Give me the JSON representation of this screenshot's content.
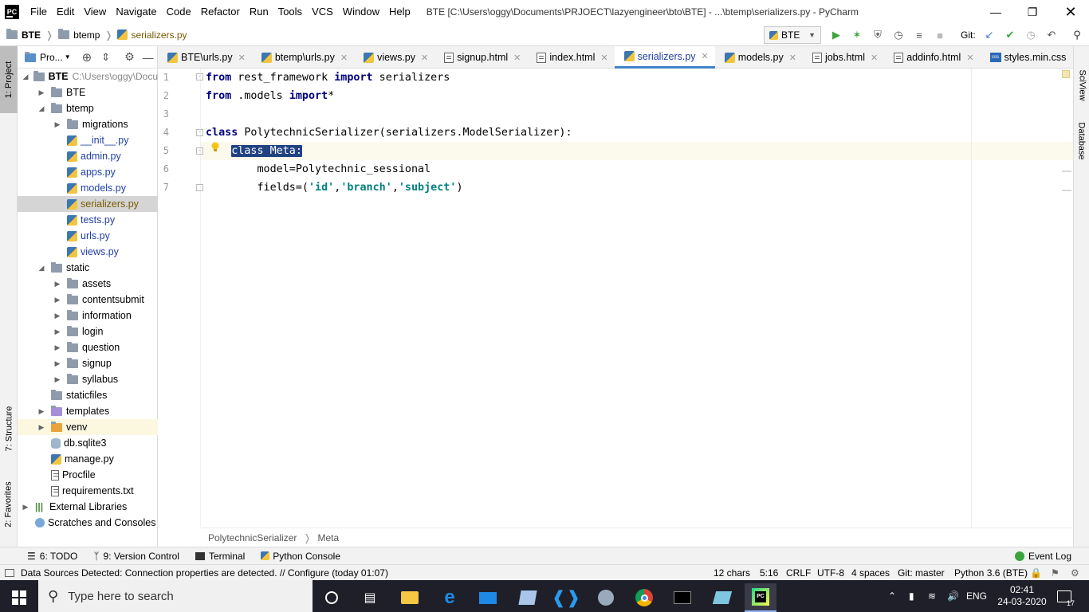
{
  "window": {
    "title": "BTE [C:\\Users\\oggy\\Documents\\PRJOECT\\lazyengineer\\bto\\BTE] - ...\\btemp\\serializers.py - PyCharm",
    "logo_text": "PC"
  },
  "menu": [
    "File",
    "Edit",
    "View",
    "Navigate",
    "Code",
    "Refactor",
    "Run",
    "Tools",
    "VCS",
    "Window",
    "Help"
  ],
  "navbar": {
    "crumbs": [
      "BTE",
      "btemp",
      "serializers.py"
    ],
    "run_config": "BTE",
    "git_label": "Git:"
  },
  "left_stripe": {
    "project": "1: Project",
    "structure": "7: Structure",
    "favorites": "2: Favorites"
  },
  "right_stripe": {
    "sciview": "SciView",
    "database": "Database"
  },
  "project_panel": {
    "title": "Pro...",
    "root": "BTE",
    "root_path": "C:\\Users\\oggy\\Docu",
    "items": [
      {
        "label": "BTE",
        "type": "folder",
        "depth": 1,
        "arrow": "collapsed"
      },
      {
        "label": "btemp",
        "type": "folder",
        "depth": 1,
        "arrow": "expanded"
      },
      {
        "label": "migrations",
        "type": "folder",
        "depth": 2,
        "arrow": "collapsed"
      },
      {
        "label": "__init__.py",
        "type": "py",
        "depth": 2
      },
      {
        "label": "admin.py",
        "type": "py",
        "depth": 2
      },
      {
        "label": "apps.py",
        "type": "py",
        "depth": 2
      },
      {
        "label": "models.py",
        "type": "py",
        "depth": 2
      },
      {
        "label": "serializers.py",
        "type": "py",
        "depth": 2,
        "selected": true
      },
      {
        "label": "tests.py",
        "type": "py",
        "depth": 2
      },
      {
        "label": "urls.py",
        "type": "py",
        "depth": 2
      },
      {
        "label": "views.py",
        "type": "py",
        "depth": 2
      },
      {
        "label": "static",
        "type": "folder",
        "depth": 1,
        "arrow": "expanded"
      },
      {
        "label": "assets",
        "type": "folder",
        "depth": 2,
        "arrow": "collapsed"
      },
      {
        "label": "contentsubmit",
        "type": "folder",
        "depth": 2,
        "arrow": "collapsed"
      },
      {
        "label": "information",
        "type": "folder",
        "depth": 2,
        "arrow": "collapsed"
      },
      {
        "label": "login",
        "type": "folder",
        "depth": 2,
        "arrow": "collapsed"
      },
      {
        "label": "question",
        "type": "folder",
        "depth": 2,
        "arrow": "collapsed"
      },
      {
        "label": "signup",
        "type": "folder",
        "depth": 2,
        "arrow": "collapsed"
      },
      {
        "label": "syllabus",
        "type": "folder",
        "depth": 2,
        "arrow": "collapsed"
      },
      {
        "label": "staticfiles",
        "type": "folder",
        "depth": 1
      },
      {
        "label": "templates",
        "type": "folder-purple",
        "depth": 1,
        "arrow": "collapsed"
      },
      {
        "label": "venv",
        "type": "folder-orange",
        "depth": 1,
        "arrow": "collapsed",
        "highlight": true
      },
      {
        "label": "db.sqlite3",
        "type": "db",
        "depth": 1
      },
      {
        "label": "manage.py",
        "type": "py",
        "depth": 1
      },
      {
        "label": "Procfile",
        "type": "text",
        "depth": 1
      },
      {
        "label": "requirements.txt",
        "type": "text",
        "depth": 1
      },
      {
        "label": "External Libraries",
        "type": "lib",
        "depth": 0,
        "arrow": "collapsed"
      },
      {
        "label": "Scratches and Consoles",
        "type": "scratch",
        "depth": 0
      }
    ]
  },
  "tabs": [
    {
      "label": "BTE\\urls.py",
      "type": "py"
    },
    {
      "label": "btemp\\urls.py",
      "type": "py"
    },
    {
      "label": "views.py",
      "type": "py"
    },
    {
      "label": "signup.html",
      "type": "html"
    },
    {
      "label": "index.html",
      "type": "html"
    },
    {
      "label": "serializers.py",
      "type": "py",
      "active": true
    },
    {
      "label": "models.py",
      "type": "py"
    },
    {
      "label": "jobs.html",
      "type": "html"
    },
    {
      "label": "addinfo.html",
      "type": "html"
    },
    {
      "label": "styles.min.css",
      "type": "css"
    }
  ],
  "editor": {
    "line_numbers": [
      "1",
      "2",
      "3",
      "4",
      "5",
      "6",
      "7"
    ],
    "line1": {
      "kw1": "from",
      "t1": " rest_framework ",
      "kw2": "import",
      "t2": " serializers"
    },
    "line2": {
      "kw1": "from",
      "t1": " .models ",
      "kw2": "import",
      "t2": "*"
    },
    "line4": {
      "kw1": "class",
      "t1": " PolytechnicSerializer(serializers.ModelSerializer):"
    },
    "line5": {
      "indent": "    ",
      "selected": "class Meta:"
    },
    "line6": {
      "text": "        model=Polytechnic_sessional"
    },
    "line7": {
      "t1": "        fields=(",
      "s1": "'id'",
      "c1": ",",
      "s2": "'branch'",
      "c2": ",",
      "s3": "'subject'",
      "t2": ")"
    }
  },
  "breadcrumb": {
    "items": [
      "PolytechnicSerializer",
      "Meta"
    ]
  },
  "tool_tabs": {
    "todo": "6: TODO",
    "vcs": "9: Version Control",
    "terminal": "Terminal",
    "python_console": "Python Console",
    "event_log": "Event Log"
  },
  "status": {
    "message": "Data Sources Detected: Connection properties are detected. // Configure (today 01:07)",
    "chars": "12 chars",
    "position": "5:16",
    "line_sep": "CRLF",
    "encoding": "UTF-8",
    "indent": "4 spaces",
    "git": "Git: master",
    "interpreter": "Python 3.6 (BTE)"
  },
  "taskbar": {
    "search_placeholder": "Type here to search",
    "lang": "ENG",
    "time": "02:41",
    "date": "24-03-2020",
    "notif_count": "17"
  }
}
